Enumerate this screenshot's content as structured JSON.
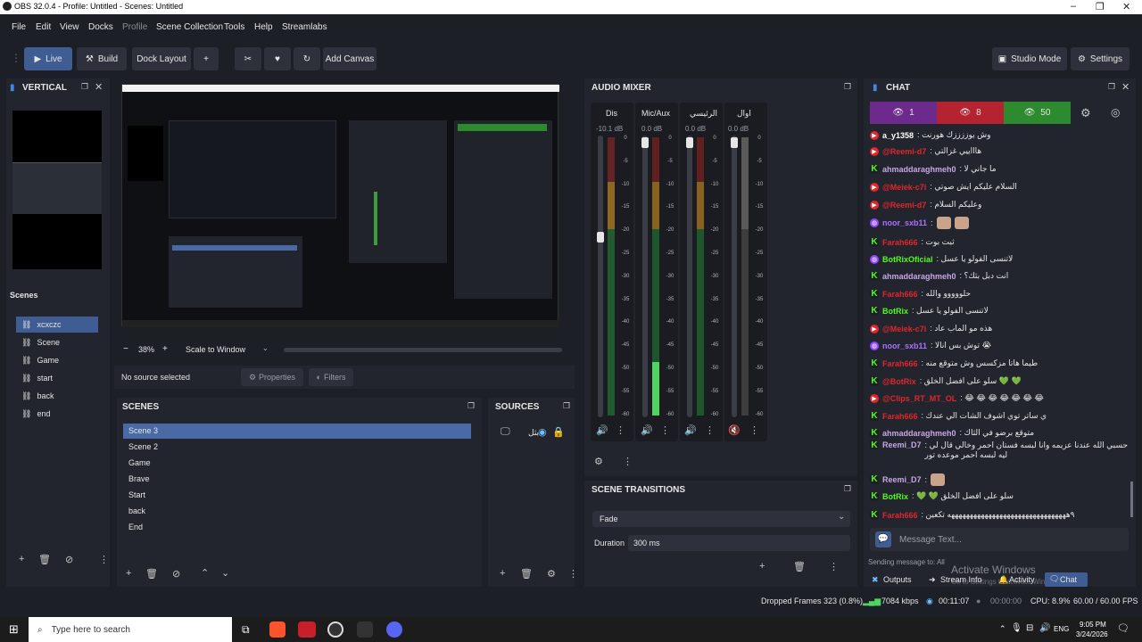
{
  "window": {
    "title": "OBS 32.0.4 - Profile: Untitled - Scenes: Untitled"
  },
  "menu": [
    "File",
    "Edit",
    "View",
    "Docks",
    "Profile",
    "Scene Collection",
    "Tools",
    "Help",
    "Streamlabs"
  ],
  "toolbar": {
    "live": "Live",
    "build": "Build",
    "dock_layout": "Dock Layout",
    "add": "+",
    "add_canvas": "Add Canvas",
    "studio_mode": "Studio Mode",
    "settings": "Settings"
  },
  "vertical": {
    "title": "VERTICAL",
    "scenes_label": "Scenes",
    "scenes": [
      "xcxczc",
      "Scene",
      "Game",
      "start",
      "back",
      "end"
    ]
  },
  "preview": {
    "zoom_minus": "−",
    "zoom": "38%",
    "zoom_plus": "+",
    "scale_mode": "Scale to Window",
    "no_source": "No source selected",
    "properties": "Properties",
    "filters": "Filters"
  },
  "scenes_dock": {
    "title": "SCENES",
    "items": [
      "Scene 3",
      "Scene 2",
      "Game",
      "Brave",
      "Start",
      "back",
      "End"
    ],
    "selected": 0
  },
  "sources_dock": {
    "title": "SOURCES",
    "item_label": "بثل"
  },
  "audio_mixer": {
    "title": "AUDIO MIXER",
    "channels": [
      {
        "name": "Dis",
        "db": "-10.1 dB"
      },
      {
        "name": "Mic/Aux",
        "db": "0.0 dB"
      },
      {
        "name": "الرئيسي",
        "db": "0.0 dB"
      },
      {
        "name": "اوال",
        "db": "0.0 dB"
      }
    ],
    "scale": [
      "0",
      "-5",
      "-10",
      "-15",
      "-20",
      "-25",
      "-30",
      "-35",
      "-40",
      "-45",
      "-50",
      "-55",
      "-60"
    ]
  },
  "transitions": {
    "title": "SCENE TRANSITIONS",
    "type": "Fade",
    "duration_label": "Duration",
    "duration": "300 ms"
  },
  "chat": {
    "title": "CHAT",
    "viewers": [
      {
        "count": "1",
        "color": "#6b2a8c"
      },
      {
        "count": "8",
        "color": "#b52330"
      },
      {
        "count": "50",
        "color": "#2e8a2e"
      }
    ],
    "messages": [
      {
        "platform": "yt",
        "user": "a_y1358",
        "color": "#ffffff",
        "text": ": وش يوززززك هورنت"
      },
      {
        "platform": "yt",
        "user": "@Reemi-d7",
        "color": "#e0262b",
        "text": ": هاااييي غزالتي"
      },
      {
        "platform": "kk",
        "user": "ahmaddaraghmeh0",
        "color": "#c7a6e8",
        "text": ": ما جاني لا"
      },
      {
        "platform": "yt",
        "user": "@Meiek-c7i",
        "color": "#e0262b",
        "text": ": السلام عليكم ايش صوتي"
      },
      {
        "platform": "yt",
        "user": "@Reemi-d7",
        "color": "#e0262b",
        "text": ": وعليكم السلام"
      },
      {
        "platform": "tw",
        "user": "noor_sxb11",
        "color": "#a970ff",
        "text": ":"
      },
      {
        "platform": "kk",
        "user": "Farah666",
        "color": "#e0262b",
        "text": ": ثبت بوت"
      },
      {
        "platform": "tw",
        "user": "BotRixOficial",
        "color": "#53fc18",
        "text": ": لاتنسى الفولو يا عسل"
      },
      {
        "platform": "kk",
        "user": "ahmaddaraghmeh0",
        "color": "#c7a6e8",
        "text": ": انت دبل بثك؟"
      },
      {
        "platform": "kk",
        "user": "Farah666",
        "color": "#e0262b",
        "text": ": حلووووو والله"
      },
      {
        "platform": "kk",
        "user": "BotRix",
        "color": "#53fc18",
        "text": ": لاتنسى الفولو يا عسل"
      },
      {
        "platform": "yt",
        "user": "@Meiek-c7i",
        "color": "#e0262b",
        "text": ": هذه مو الماب عاد"
      },
      {
        "platform": "tw",
        "user": "noor_sxb11",
        "color": "#a970ff",
        "text": ": توش بس انالا 😭"
      },
      {
        "platform": "kk",
        "user": "Farah666",
        "color": "#e0262b",
        "text": ": طيما هاتا مزكسس وش متوقع منه"
      },
      {
        "platform": "kk",
        "user": "@BotRix",
        "color": "#e0262b",
        "text": ": سلو على افضل الخلق 💚 💚"
      },
      {
        "platform": "yt",
        "user": "@Clips_RT_MT_OL",
        "color": "#e0262b",
        "text": ": 😂 😂 😂 😂 😂 😂 😂"
      },
      {
        "platform": "kk",
        "user": "Farah666",
        "color": "#e0262b",
        "text": ": ي ساتر توي اشوف الشات الي عندك"
      },
      {
        "platform": "kk",
        "user": "ahmaddaraghmeh0",
        "color": "#c7a6e8",
        "text": ": متوقع برضو في الثاك"
      },
      {
        "platform": "kk",
        "user": "Reemi_D7",
        "color": "#c7a6e8",
        "text": ": حسبي الله عندنا عزيمه وانا لبسه فستان احمر وخالي قال لي ليه لبسه احمر موعده تور"
      },
      {
        "platform": "kk",
        "user": "Reemi_D7",
        "color": "#c7a6e8",
        "text": ":"
      },
      {
        "platform": "kk",
        "user": "BotRix",
        "color": "#53fc18",
        "text": ": 💚 💚 سلو على افضل الخلق"
      },
      {
        "platform": "kk",
        "user": "Farah666",
        "color": "#e0262b",
        "text": ": ٩ههههههههههههههههههههههههههههههههه تكعين"
      }
    ],
    "input_placeholder": "Message Text...",
    "sending_to": "Sending message to: All",
    "tabs": [
      "Outputs",
      "Stream Info",
      "Activity",
      "Chat"
    ]
  },
  "watermark": {
    "line1": "Activate Windows",
    "line2": "Go to Settings to activate Windows."
  },
  "status": {
    "dropped": "Dropped Frames 323 (0.8%)",
    "bitrate": "7084 kbps",
    "stream_time": "00:11:07",
    "rec_time": "00:00:00",
    "cpu": "CPU: 8.9%",
    "fps": "60.00 / 60.00 FPS"
  },
  "taskbar": {
    "search": "Type here to search",
    "lang": "ENG",
    "time": "9:05 PM",
    "date": "3/24/2026"
  }
}
